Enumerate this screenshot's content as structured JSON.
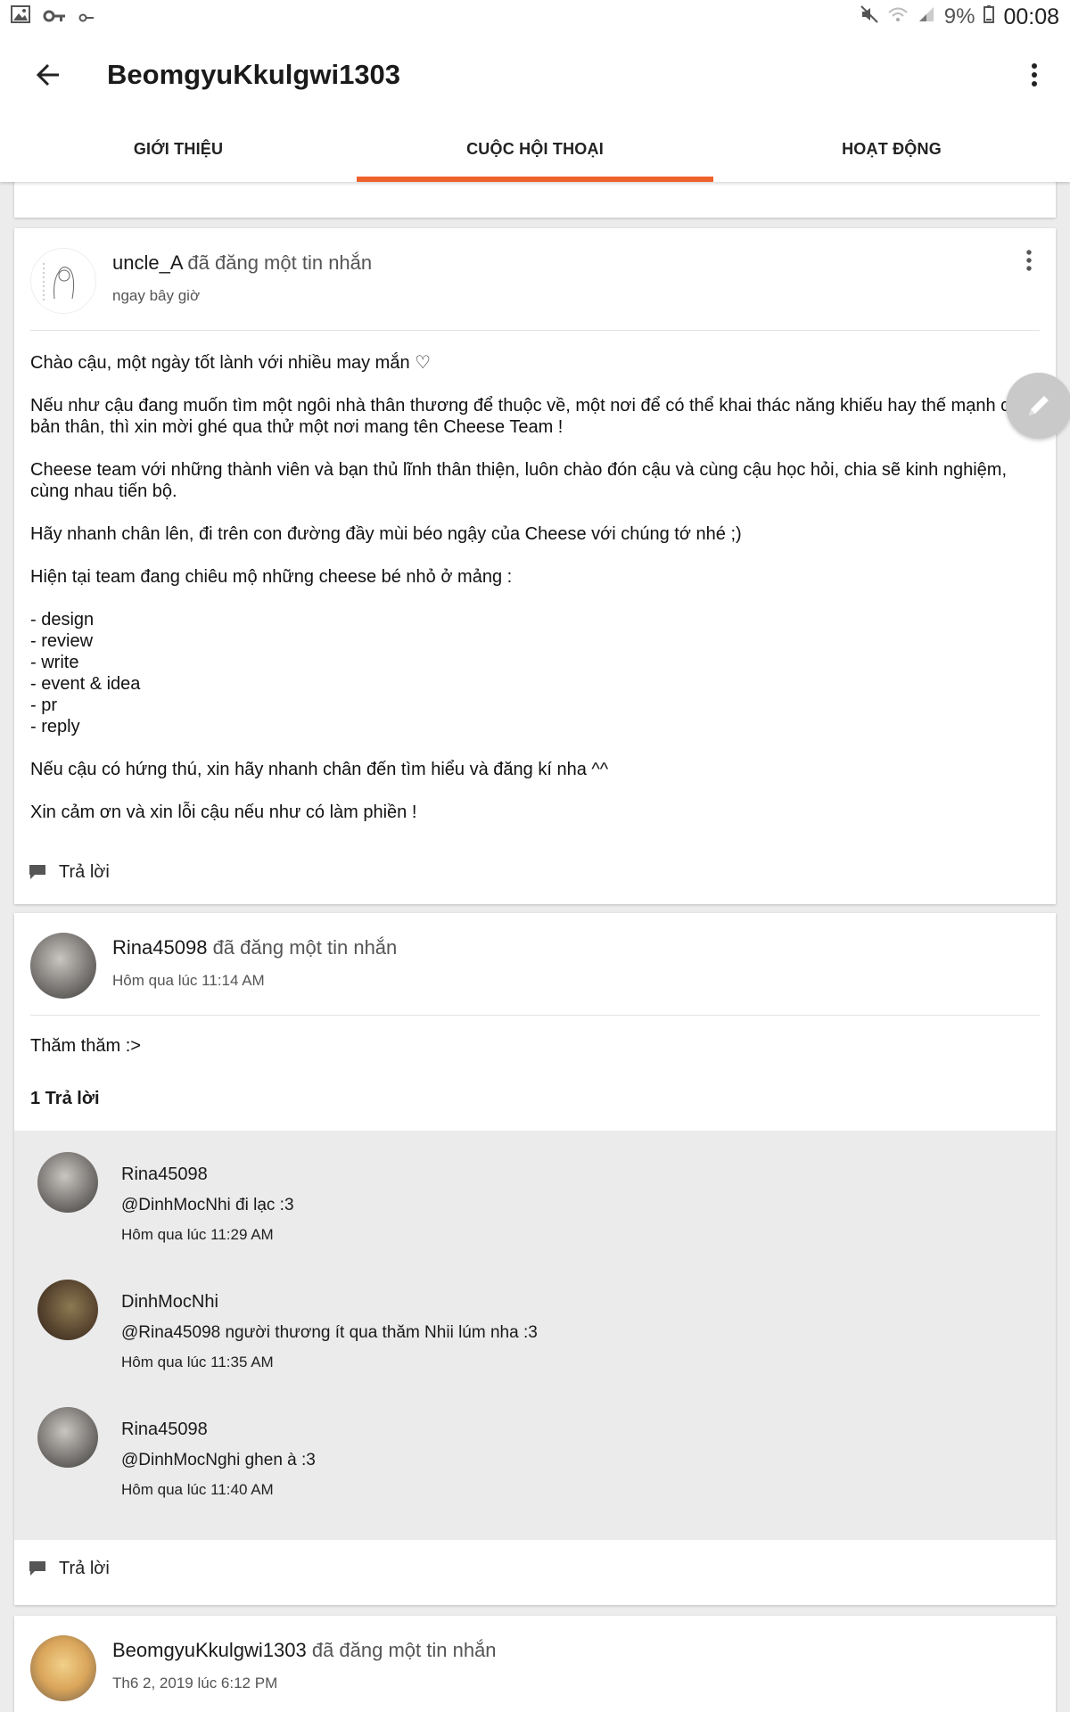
{
  "status_bar": {
    "battery": "9%",
    "time": "00:08",
    "icons": [
      "image-icon",
      "key-icon",
      "key-small-icon",
      "mute-icon",
      "wifi-icon",
      "signal-icon",
      "battery-icon"
    ]
  },
  "app_bar": {
    "title": "BeomgyuKkulgwi1303"
  },
  "tabs": [
    {
      "label": "GIỚI THIỆU"
    },
    {
      "label": "CUỘC HỘI THOẠI"
    },
    {
      "label": "HOẠT ĐỘNG"
    }
  ],
  "active_tab": "CUỘC HỘI THOẠI",
  "colors": {
    "accent": "#f0622c",
    "fab": "#c9c9c9",
    "reply_bg": "#ebebeb"
  },
  "posts": [
    {
      "user": "uncle_A",
      "action": "đã đăng một tin nhắn",
      "time": "ngay bây giờ",
      "paragraphs": [
        "Chào cậu, một ngày tốt lành với nhiều may mắn ♡",
        "Nếu như cậu đang muốn tìm một ngôi nhà thân thương để thuộc về, một nơi để có thể khai thác năng khiếu hay thế mạnh của bản thân, thì xin mời ghé qua thử một nơi mang tên Cheese Team !",
        "Cheese team với những thành viên và bạn thủ lĩnh thân thiện, luôn chào đón cậu và cùng cậu học hỏi, chia sẽ kinh nghiệm, cùng nhau tiến bộ.",
        "Hãy nhanh chân lên, đi trên con đường đầy mùi béo ngậy của Cheese với chúng tớ nhé ;)",
        "Hiện tại team đang chiêu mộ những cheese bé nhỏ ở mảng :",
        "LIST",
        "Nếu cậu có hứng thú, xin hãy nhanh chân đến tìm hiểu và đăng kí nha ^^",
        "Xin cảm ơn và xin lỗi cậu nếu như có làm phiền !"
      ],
      "list": [
        "- design",
        "- review",
        "- write",
        "- event & idea",
        "- pr",
        "- reply"
      ],
      "reply_label": "Trả lời"
    },
    {
      "user": "Rina45098",
      "action": "đã đăng một tin nhắn",
      "time": "Hôm qua lúc 11:14 AM",
      "text": "Thăm thăm :>",
      "replies_count": "1 Trả lời",
      "replies": [
        {
          "user": "Rina45098",
          "text": "@DinhMocNhi đi lạc :3",
          "time": "Hôm qua lúc 11:29 AM"
        },
        {
          "user": "DinhMocNhi",
          "text": "@Rina45098 người thương ít qua thăm Nhii lúm nha :3",
          "time": "Hôm qua lúc 11:35 AM"
        },
        {
          "user": "Rina45098",
          "text": "@DinhMocNghi ghen à :3",
          "time": "Hôm qua lúc 11:40 AM"
        }
      ],
      "reply_label": "Trả lời"
    },
    {
      "user": "BeomgyuKkulgwi1303",
      "action": "đã đăng một tin nhắn",
      "time": "Th6 2, 2019 lúc 6:12 PM"
    }
  ]
}
